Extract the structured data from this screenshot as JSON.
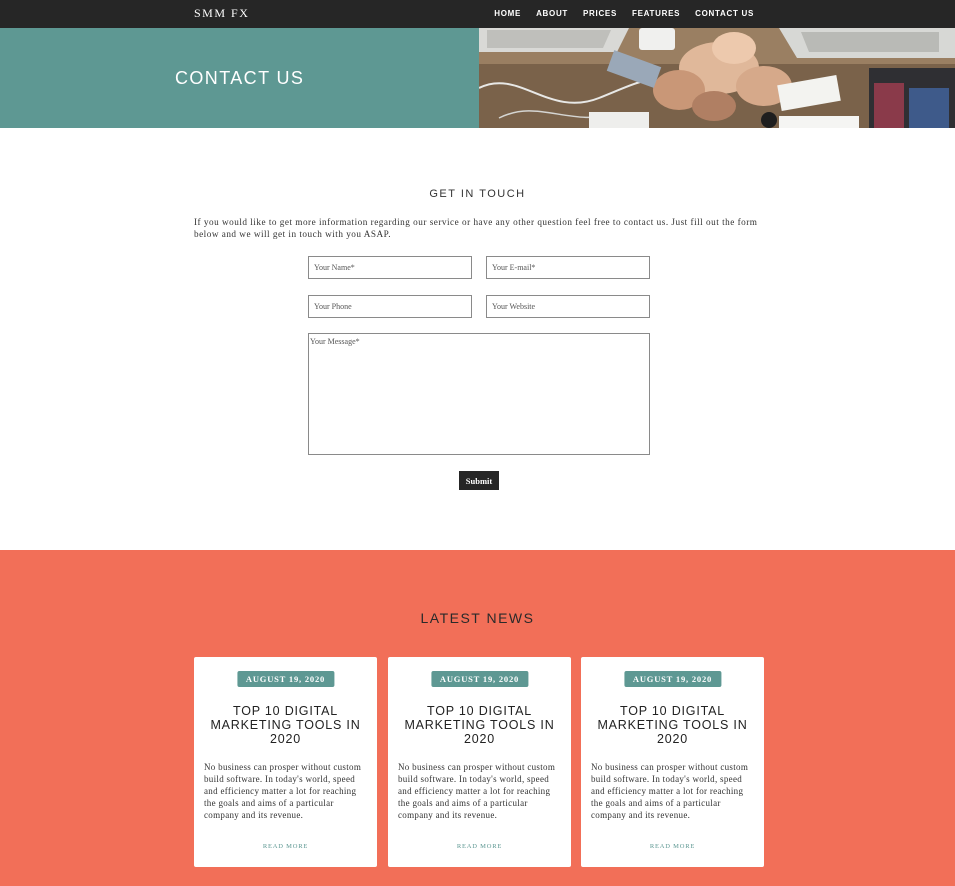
{
  "nav": {
    "logo": "SMM FX",
    "items": [
      {
        "label": "HOME"
      },
      {
        "label": "ABOUT"
      },
      {
        "label": "PRICES"
      },
      {
        "label": "FEATURES"
      },
      {
        "label": "CONTACT US"
      }
    ]
  },
  "hero": {
    "title": "CONTACT US"
  },
  "contact": {
    "heading": "GET IN TOUCH",
    "intro": "If you would like to get more information regarding our service or have any other question feel free to contact us. Just fill out the form below and we will get in touch with you ASAP.",
    "fields": {
      "name": {
        "placeholder": "Your Name*",
        "value": ""
      },
      "email": {
        "placeholder": "Your E-mail*",
        "value": ""
      },
      "phone": {
        "placeholder": "Your Phone",
        "value": ""
      },
      "website": {
        "placeholder": "Your Website",
        "value": ""
      },
      "message": {
        "placeholder": "Your Message*",
        "value": ""
      }
    },
    "submit_label": "Submit"
  },
  "news": {
    "heading": "LATEST NEWS",
    "cards": [
      {
        "date": "AUGUST 19, 2020",
        "title": "TOP 10 DIGITAL MARKETING TOOLS IN 2020",
        "text": "No business can prosper without custom build software. In today's world, speed and efficiency matter a lot for reaching the goals and aims of a particular company and its revenue.",
        "link": "READ MORE"
      },
      {
        "date": "AUGUST 19, 2020",
        "title": "TOP 10 DIGITAL MARKETING TOOLS IN 2020",
        "text": "No business can prosper without custom build software. In today's world, speed and efficiency matter a lot for reaching the goals and aims of a particular company and its revenue.",
        "link": "READ MORE"
      },
      {
        "date": "AUGUST 19, 2020",
        "title": "TOP 10 DIGITAL MARKETING TOOLS IN 2020",
        "text": "No business can prosper without custom build software. In today's world, speed and efficiency matter a lot for reaching the goals and aims of a particular company and its revenue.",
        "link": "READ MORE"
      }
    ]
  },
  "colors": {
    "nav_bg": "#262626",
    "teal": "#5e9893",
    "coral": "#f26f58",
    "white": "#ffffff"
  }
}
